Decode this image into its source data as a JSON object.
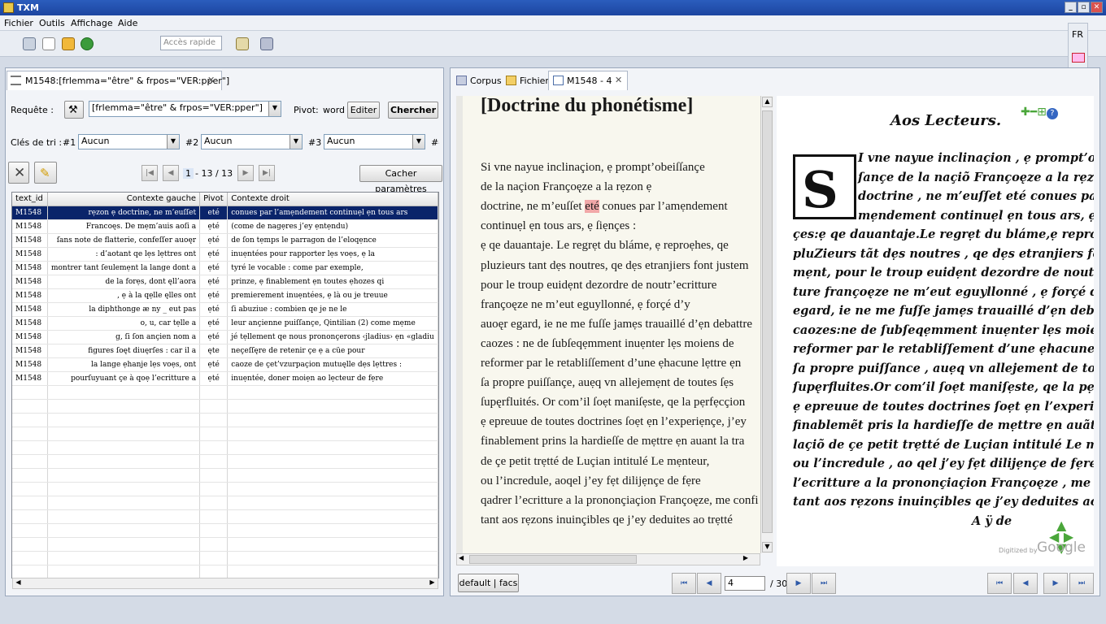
{
  "app": {
    "title": "TXM",
    "window_buttons": [
      "_",
      "▫",
      "✕"
    ]
  },
  "menu": [
    "Fichier",
    "Outils",
    "Affichage",
    "Aide"
  ],
  "toolbar": {
    "quick_access_placeholder": "Accès rapide"
  },
  "lang": "FR",
  "left": {
    "tab_label": "M1548:[frlemma=\"être\" & frpos=\"VER:pper\"]",
    "query_label": "Requête :",
    "query_value": "[frlemma=\"être\" & frpos=\"VER:pper\"]",
    "pivot_label": "Pivot:",
    "pivot_value": "word",
    "edit_button": "Editer",
    "search_button": "Chercher",
    "sort_label": "Clés de tri :",
    "sort_keys": [
      {
        "num": "#1",
        "value": "Aucun"
      },
      {
        "num": "#2",
        "value": "Aucun"
      },
      {
        "num": "#3",
        "value": "Aucun"
      },
      {
        "num": "#4",
        "value": ""
      }
    ],
    "page_current": "1",
    "page_total": "- 13 / 13",
    "hide_params_button": "Cacher paramètres",
    "columns": [
      "text_id",
      "Contexte gauche",
      "Pivot",
      "Contexte droit"
    ],
    "rows": [
      [
        "M1548",
        "rẹzon ẹ doctrine, ne m’euſſet",
        "eté",
        "conues par l’amẹndement continuẹl ẹn tous ars"
      ],
      [
        "M1548",
        "Francoęs. De mẹm’auis aoſi a",
        "ẹté",
        "(come de nagẹres j’ey ẹntẹndu)"
      ],
      [
        "M1548",
        "ſans note de flatterie, confeſſer auoęr",
        "ẹté",
        "de ſon tẹmps le parragon de l’eloqẹnce"
      ],
      [
        "M1548",
        ": d’aotant qe lẹs lẹttres ont",
        "ẹté",
        "inuẹntées pour rapporter lẹs voẹs, ẹ la"
      ],
      [
        "M1548",
        "montrer tant ſeulemẹnt la lange dont a",
        "ẹté",
        "tyré le vocable : come par exemple,"
      ],
      [
        "M1548",
        "de la forẹs, dont ęll’aora",
        "ẹté",
        "prinze, ẹ finablement ẹn toutes ẹhozes qi"
      ],
      [
        "M1548",
        ", ẹ à la qẹlle ęlles ont",
        "ẹté",
        "premierement inuẹntées, ẹ là ou je treuue"
      ],
      [
        "M1548",
        "la diphthonge æ ny _  eut pas",
        "ẹté",
        "ſi abuziue : combien qe je ne le"
      ],
      [
        "M1548",
        "o, u, car tẹlle a",
        "ẹté",
        "leur ançienne puiſſançe, Qintilian (2) come mẹme"
      ],
      [
        "M1548",
        "g, ſi ſon ançien nom a",
        "ẹté",
        "jé tẹllement qe nous prononçerons ‹jladius› ẹn «gladiu"
      ],
      [
        "M1548",
        "figures ſoęt diuęrſes : car il a",
        "ęte",
        "neçeſſęre de retenir çe ẹ a cüe pour"
      ],
      [
        "M1548",
        "la lange ẹhanje lẹs voẹs, ont",
        "ẹté",
        "caoze de çet’vzurpaçion mutuęlle dẹs lẹttres :"
      ],
      [
        "M1548",
        "pourſuyuant çe à qoẹ l’ecritture a",
        "ẹté",
        "inuẹntée, doner moiẹn ao lẹcteur de fẹre"
      ]
    ]
  },
  "right": {
    "tabs": [
      "Corpus",
      "Fichier",
      "M1548 - 4"
    ],
    "doc_title": "[Doctrine du phonétisme]",
    "text_lines": [
      {
        "t": "Si vne nayue inclinaçion, ẹ prompt’obeiſſançe"
      },
      {
        "t": "de la naçion Françoęze a la rẹzon ẹ"
      },
      {
        "pre": "doctrine, ne m’euſſet ",
        "hl": "eté",
        "post": " conues par l’amẹndement"
      },
      {
        "t": "continuẹl ẹn tous ars, ẹ ſiẹnçes :"
      },
      {
        "t": "ẹ qe dauantaje. Le regrẹt du bláme, ẹ reproẹhes, qe"
      },
      {
        "t": "pluzieurs tant dẹs noutres, qe dẹs etranjiers font justem"
      },
      {
        "t": "pour le troup euidẹnt dezordre de noutr’ecritture"
      },
      {
        "t": "françoęze ne m’eut eguyllonné, ẹ forçé d’y"
      },
      {
        "t": "auoęr egard, ie ne me fuſſe jamẹs trauaillé d’ẹn debattre"
      },
      {
        "t": "caozes : ne de ſubſeqẹmment inuẹnter lẹs moiens de"
      },
      {
        "t": "reformer par le retabliſſement d’une ẹhacune lẹttre ẹn"
      },
      {
        "t": "ſa propre puiſſançe, auẹq vn allejemẹnt de toutes ſẹs"
      },
      {
        "t": "ſupęrfluités. Or com’il ſoẹt maniſẹste, qe la pẹrfẹcçion"
      },
      {
        "t": "ẹ epreuue de toutes doctrines ſoẹt ẹn l’experiẹnçe, j’ey"
      },
      {
        "t": "finablement prins la hardieſſe de mẹttre ẹn auant la tra"
      },
      {
        "t": "de çe petit trẹtté de Luçian intitulé Le mẹnteur,"
      },
      {
        "t": "ou l’incredule, aoqel j’ey fẹt dilijẹnçe de fẹre"
      },
      {
        "t": "qadrer l’ecritture a la prononçiaçion Françoęze, me confi"
      },
      {
        "t": "tant aos rẹzons inuinçibles qe j’ey deduites ao trẹtté"
      }
    ],
    "facs_heading": "Aos Lecteurs.",
    "facs_lines": [
      "I vne nayue inclinaçion , ẹ prompt’obeiſ-",
      "ſançe de la naçiõ Françoęze a la rẹzon ẹ",
      "doctrine , ne m’euſſet eté conues par l’a-",
      "mẹndement continuẹl ẹn tous ars, ẹ ſiẹn-",
      "çes:ẹ qe dauantaje.Le regrẹt du bláme,ẹ reproẹhes, qe",
      "pluZieurs tãt dẹs noutres , qe dẹs etranjiers font juſte-",
      "mẹnt, pour le troup euidẹnt dezordre de noutr’ ecrit-",
      "ture françoęze ne m’eut eguyllonné , ẹ forçé d’y auoęr",
      "egard, ie ne me fuſſe jamẹs trauaillé d’ẹn debattre lẹs",
      "caozes:ne de ſubſeqẹmment inuẹnter lẹs moiens de la",
      "reformer par le retabliſſement d’une ẹhacune lẹttre ẹn",
      "ſa propre puiſſance , auẹq vn allejement de toutes ſẹs",
      "ſupęrfluites.Or com’il ſoẹt maniſẹste, qe la pẹrfẹcçiõ,",
      "ẹ epreuue de toutes doctrines ſoẹt ẹn l’experiẹçe , j’ey",
      "finablemẽt pris la hardieſſe de mẹttre ẹn auãt la trã-",
      "laçiõ de çe petit trẹtté de Luçian intitulé Le mẹnteur,",
      "ou l’incredule , ao qel j’ey fẹt dilijẹnçe de fẹre qadrer",
      "l’ecritture a la prononçiaçion Françoęze , me confiant",
      "tant aos rẹzons inuinçibles  qe j’ey deduites ao trẹtté",
      "A  ÿ                 de"
    ],
    "digitized_label": "Digitized by",
    "google_label": "Google",
    "default_facs_button": "default | facs",
    "page_current": "4",
    "page_total": "/ 30"
  }
}
